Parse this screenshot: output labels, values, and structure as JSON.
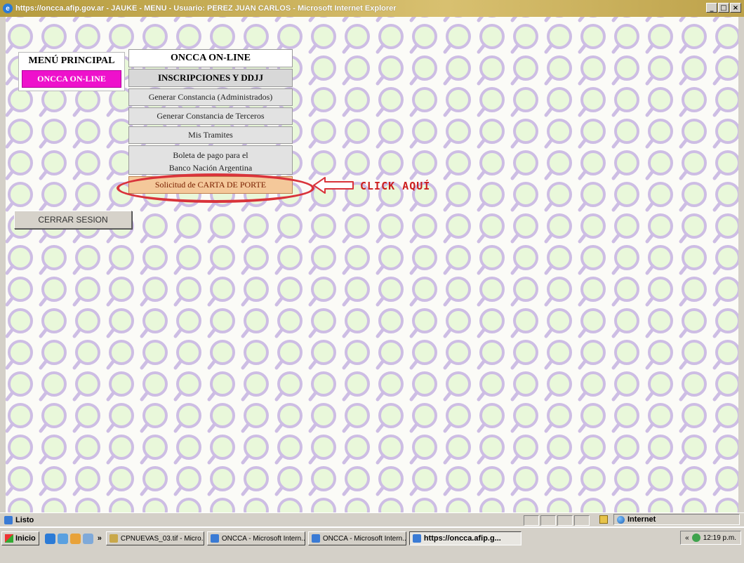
{
  "window": {
    "title": "https://oncca.afip.gov.ar - JAUKE - MENU - Usuario: PEREZ JUAN CARLOS - Microsoft Internet Explorer",
    "controls": [
      "_",
      "□",
      "×"
    ]
  },
  "page": {
    "background_pattern": "magnifier-icon",
    "accent_colors": {
      "magenta": "#ee11cc",
      "ring": "#d9333a",
      "highlight": "#f4c89a"
    },
    "menu_principal": {
      "title": "MENÚ PRINCIPAL",
      "active_item": "ONCCA ON-LINE"
    },
    "oncca_menu": {
      "header": "ONCCA ON-LINE",
      "subheader": "INSCRIPCIONES Y DDJJ",
      "items": [
        "Generar Constancia (Administrados)",
        "Generar Constancia de Terceros",
        "Mis Tramites"
      ],
      "boleta_line1": "Boleta de pago para el",
      "boleta_line2": "Banco Nación Argentina",
      "carta_porte": "Solicitud de CARTA DE PORTE"
    },
    "callout": "CLICK AQUÍ",
    "logout_button": "CERRAR SESION"
  },
  "statusbar": {
    "text": "Listo",
    "zone": "Internet"
  },
  "taskbar": {
    "start_label": "Inicio",
    "overflow": "»",
    "tasks": [
      {
        "label": "CPNUEVAS_03.tif - Micro..."
      },
      {
        "label": "ONCCA - Microsoft Intern..."
      },
      {
        "label": "ONCCA - Microsoft Intern..."
      },
      {
        "label": "https://oncca.afip.g...",
        "active": true
      }
    ],
    "tray": {
      "arrows": "«",
      "clock": "12:19 p.m."
    }
  }
}
